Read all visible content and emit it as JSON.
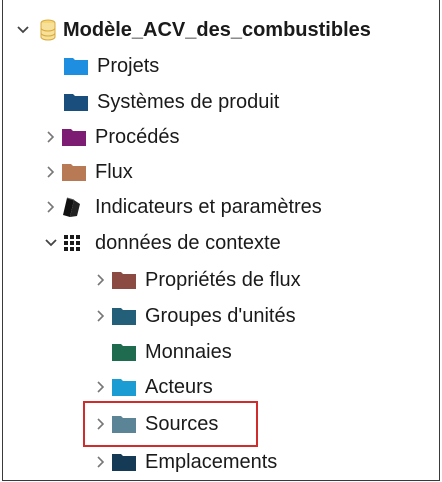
{
  "tree": {
    "root": {
      "label": "Modèle_ACV_des_combustibles",
      "icon": "database-icon",
      "expanded": true
    },
    "items": [
      {
        "label": "Projets",
        "icon": "folder-icon",
        "color": "#1e8fe0"
      },
      {
        "label": "Systèmes de produit",
        "icon": "folder-icon",
        "color": "#1a4e7c"
      },
      {
        "label": "Procédés",
        "icon": "folder-icon",
        "color": "#7d1c73"
      },
      {
        "label": "Flux",
        "icon": "folder-icon",
        "color": "#b87a55"
      },
      {
        "label": "Indicateurs et paramètres",
        "icon": "indicators-icon",
        "color": "#111111"
      },
      {
        "label": "données de contexte",
        "icon": "grid-icon",
        "color": "#1a1a1a"
      }
    ],
    "context_children": [
      {
        "label": "Propriétés de flux",
        "icon": "folder-icon",
        "color": "#8c4b42"
      },
      {
        "label": "Groupes d'unités",
        "icon": "folder-icon",
        "color": "#245f7a"
      },
      {
        "label": "Monnaies",
        "icon": "folder-icon",
        "color": "#1f6b50"
      },
      {
        "label": "Acteurs",
        "icon": "folder-icon",
        "color": "#1b9dd4"
      },
      {
        "label": "Sources",
        "icon": "folder-icon",
        "color": "#5b8597",
        "highlighted": true
      },
      {
        "label": "Emplacements",
        "icon": "folder-icon",
        "color": "#143a55"
      }
    ],
    "highlight_color": "#d12c2c"
  }
}
